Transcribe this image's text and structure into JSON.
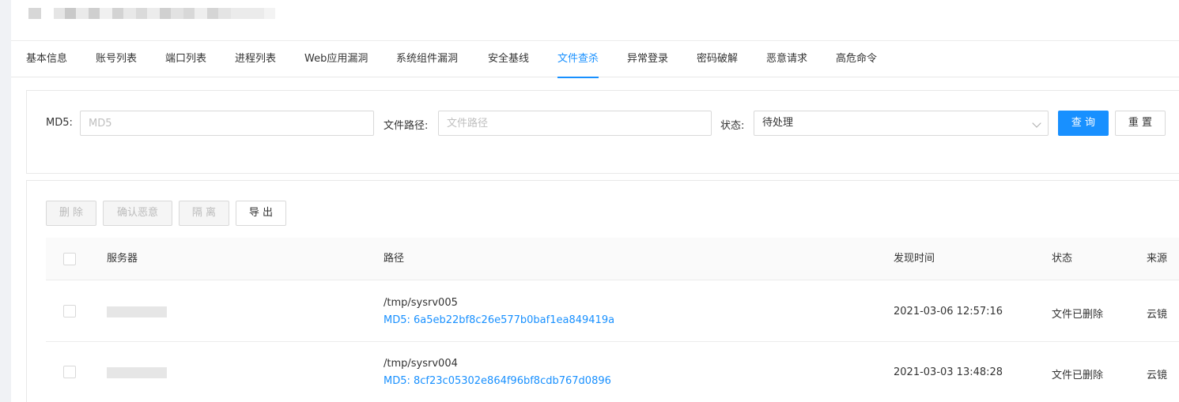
{
  "tabs": [
    {
      "label": "基本信息"
    },
    {
      "label": "账号列表"
    },
    {
      "label": "端口列表"
    },
    {
      "label": "进程列表"
    },
    {
      "label": "Web应用漏洞"
    },
    {
      "label": "系统组件漏洞"
    },
    {
      "label": "安全基线"
    },
    {
      "label": "文件查杀"
    },
    {
      "label": "异常登录"
    },
    {
      "label": "密码破解"
    },
    {
      "label": "恶意请求"
    },
    {
      "label": "高危命令"
    }
  ],
  "active_tab": "文件查杀",
  "filter": {
    "md5_label": "MD5:",
    "md5_placeholder": "MD5",
    "path_label": "文件路径:",
    "path_placeholder": "文件路径",
    "status_label": "状态:",
    "status_value": "待处理",
    "query_label": "查 询",
    "reset_label": "重 置"
  },
  "actions": {
    "delete_label": "删 除",
    "confirm_label": "确认恶意",
    "isolate_label": "隔 离",
    "export_label": "导 出"
  },
  "table": {
    "columns": [
      "服务器",
      "路径",
      "发现时间",
      "状态",
      "来源"
    ],
    "rows": [
      {
        "path": "/tmp/sysrv005",
        "md5": "MD5: 6a5eb22bf8c26e577b0baf1ea849419a",
        "time": "2021-03-06 12:57:16",
        "status": "文件已删除",
        "source": "云镜"
      },
      {
        "path": "/tmp/sysrv004",
        "md5": "MD5: 8cf23c05302e864f96bf8cdb767d0896",
        "time": "2021-03-03 13:48:28",
        "status": "文件已删除",
        "source": "云镜"
      }
    ]
  },
  "colors": {
    "accent": "#1890ff",
    "border": "#d9d9d9",
    "header_bg": "#fafafa"
  }
}
